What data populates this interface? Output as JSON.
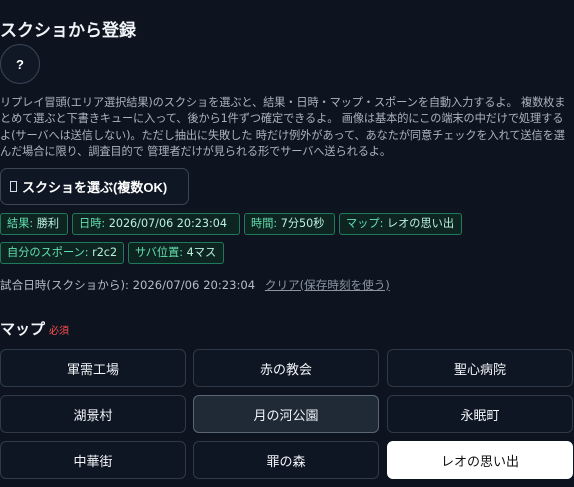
{
  "section": {
    "title": "スクショから登録",
    "help_label": "?",
    "description": "リプレイ冒頭(エリア選択結果)のスクショを選ぶと、結果・日時・マップ・スポーンを自動入力するよ。 複数枚まとめて選ぶと下書きキューに入って、後から1件ずつ確定できるよ。 画像は基本的にこの端末の中だけで処理するよ(サーバへは送信しない)。ただし抽出に失敗した 時だけ例外があって、あなたが同意チェックを入れて送信を選んだ場合に限り、調査目的で 管理者だけが見られる形でサーバへ送られるよ。",
    "select_button": "スクショを選ぶ(複数OK)"
  },
  "badges": [
    {
      "label": "結果: ",
      "value": "勝利"
    },
    {
      "label": "日時: ",
      "value": "2026/07/06 20:23:04"
    },
    {
      "label": "時間: ",
      "value": "7分50秒"
    },
    {
      "label": "マップ: ",
      "value": "レオの思い出"
    },
    {
      "label": "自分のスポーン: ",
      "value": "r2c2"
    },
    {
      "label": "サバ位置: ",
      "value": "4マス"
    }
  ],
  "match_datetime": {
    "label": "試合日時(スクショから): ",
    "value": "2026/07/06 20:23:04",
    "clear_link": "クリア(保存時刻を使う)"
  },
  "map": {
    "label": "マップ",
    "required": "必須",
    "options": [
      "軍需工場",
      "赤の教会",
      "聖心病院",
      "湖景村",
      "月の河公園",
      "永眠町",
      "中華街",
      "罪の森",
      "レオの思い出"
    ],
    "hovered": "月の河公園",
    "selected": "レオの思い出"
  },
  "colors": {
    "background": "#0d1420",
    "badge_border": "#1f7a5a",
    "badge_text": "#62e0b0",
    "required": "#ff4d4d",
    "selected_bg": "#ffffff"
  },
  "icons": {
    "select_button_icon": "file-icon"
  }
}
